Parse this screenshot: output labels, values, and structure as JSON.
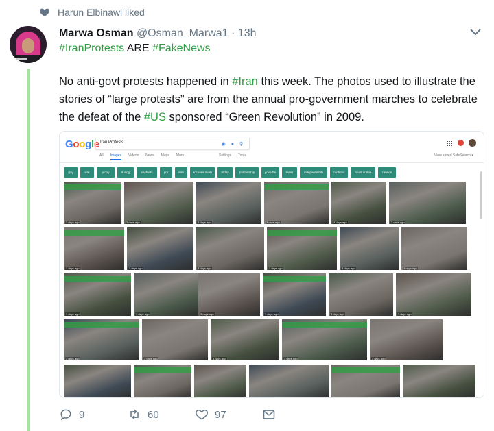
{
  "liked_by": {
    "text": "Harun Elbinawi liked",
    "icon": "heart-icon"
  },
  "tweet": {
    "author": {
      "display_name": "Marwa Osman",
      "handle": "@Osman_Marwa1",
      "time": "13h"
    },
    "line1": {
      "tag1": "#IranProtests",
      "mid": " ARE ",
      "tag2": "#FakeNews"
    },
    "body": {
      "p1": "No anti-govt protests happened in ",
      "tag_iran": "#Iran",
      "p2": " this week. The photos used to illustrate the stories of “large protests” are from the annual pro-government marches to celebrate the defeat of the ",
      "tag_us": "#US",
      "p3": " sponsored “Green Revolution” in 2009."
    },
    "stats": {
      "replies": "9",
      "retweets": "60",
      "likes": "97"
    }
  },
  "google": {
    "logo": [
      "G",
      "o",
      "o",
      "g",
      "l",
      "e"
    ],
    "logo_colors": [
      "#4285f4",
      "#ea4335",
      "#fbbc05",
      "#4285f4",
      "#34a853",
      "#ea4335"
    ],
    "query": "Iran Protests",
    "tabs": [
      "All",
      "Images",
      "Videos",
      "News",
      "Maps",
      "More"
    ],
    "active_tab": "Images",
    "tools": [
      "Settings",
      "Tools"
    ],
    "saved": "View saved   SafeSearch ▾",
    "chips": [
      "guy",
      "war",
      "proxy",
      "during",
      "students",
      "pro",
      "iran",
      "accuses rivals",
      "friday",
      "partnership",
      "youtube",
      "leans",
      "independently",
      "confirms",
      "saudi arabia",
      "cannon"
    ],
    "thumb_caption": "3 days ago"
  },
  "colors": {
    "accent_green": "#2f9e44",
    "chip_teal": "#2e8b7a",
    "muted": "#657786"
  }
}
